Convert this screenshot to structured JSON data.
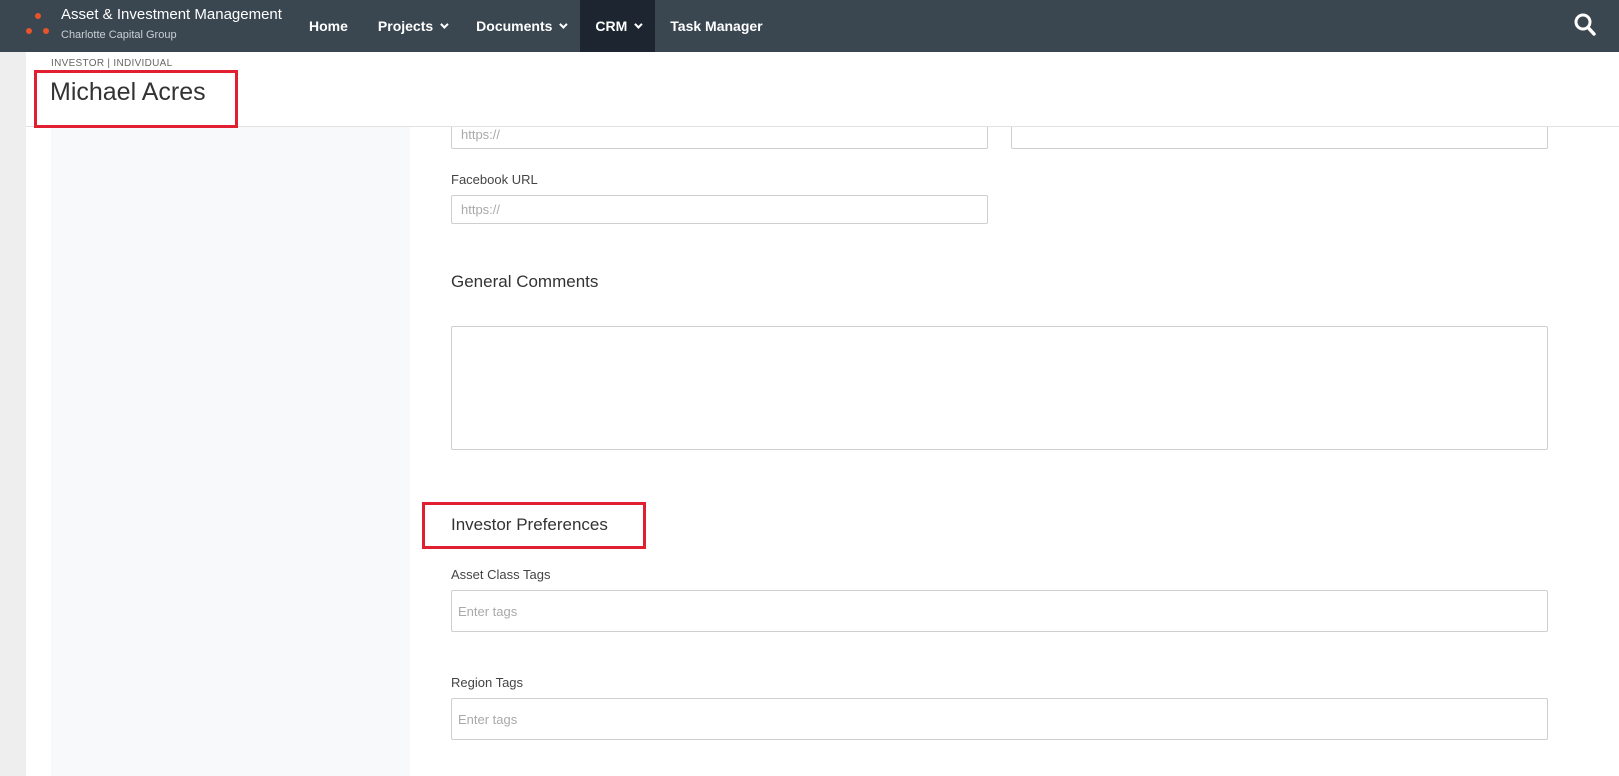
{
  "app": {
    "title": "Asset & Investment Management",
    "subtitle": "Charlotte Capital Group",
    "logo_icon": "three-dots-logo-icon",
    "accent_color": "#e8542a",
    "nav_bg": "#3a4650"
  },
  "nav": {
    "items": [
      {
        "label": "Home"
      },
      {
        "label": "Projects"
      },
      {
        "label": "Documents"
      },
      {
        "label": "CRM"
      },
      {
        "label": "Task Manager"
      }
    ],
    "active": "CRM",
    "search_icon": "search-icon"
  },
  "record": {
    "type": "INVESTOR | INDIVIDUAL",
    "name": "Michael Acres"
  },
  "form": {
    "url_placeholder": "https://",
    "facebook_label": "Facebook URL",
    "facebook_placeholder": "https://",
    "general_comments_title": "General Comments",
    "investor_preferences_title": "Investor Preferences",
    "asset_class_label": "Asset Class Tags",
    "asset_class_placeholder": "Enter tags",
    "region_label": "Region Tags",
    "region_placeholder": "Enter tags"
  },
  "highlight_color": "#e02030"
}
